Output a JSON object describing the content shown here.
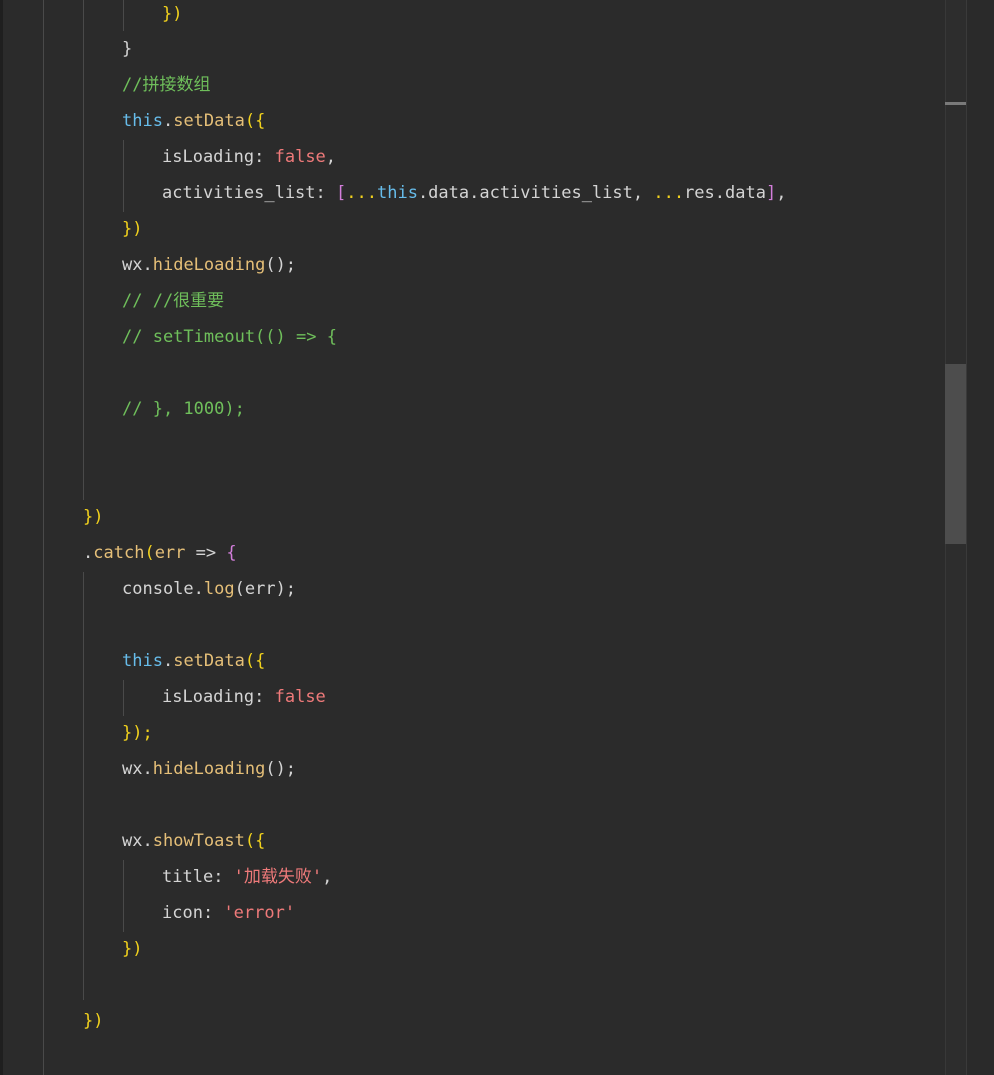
{
  "editor": {
    "colors": {
      "background": "#2b2b2b",
      "keyword": "#67bcea",
      "function": "#e5bf78",
      "brace": "#f2d21d",
      "bracket": "#d37edb",
      "boolean": "#ef7a7a",
      "comment": "#6fbf5b",
      "string": "#ef7a7a"
    },
    "lines": [
      {
        "tokens": [
          {
            "t": "})",
            "c": "brace"
          }
        ]
      },
      {
        "tokens": [
          {
            "t": "}",
            "c": "plain"
          }
        ]
      },
      {
        "tokens": [
          {
            "t": "//拼接数组",
            "c": "comment"
          }
        ]
      },
      {
        "tokens": [
          {
            "t": "this",
            "c": "kw"
          },
          {
            "t": ".",
            "c": "punct"
          },
          {
            "t": "setData",
            "c": "fn"
          },
          {
            "t": "({",
            "c": "brace"
          }
        ]
      },
      {
        "tokens": [
          {
            "t": "isLoading",
            "c": "plain"
          },
          {
            "t": ": ",
            "c": "punct"
          },
          {
            "t": "false",
            "c": "bool"
          },
          {
            "t": ",",
            "c": "punct"
          }
        ]
      },
      {
        "tokens": [
          {
            "t": "activities_list",
            "c": "plain"
          },
          {
            "t": ": ",
            "c": "punct"
          },
          {
            "t": "[",
            "c": "bracket"
          },
          {
            "t": "...",
            "c": "brace"
          },
          {
            "t": "this",
            "c": "kw"
          },
          {
            "t": ".data.activities_list, ",
            "c": "plain"
          },
          {
            "t": "...",
            "c": "brace"
          },
          {
            "t": "res.data",
            "c": "plain"
          },
          {
            "t": "]",
            "c": "bracket"
          },
          {
            "t": ",",
            "c": "punct"
          }
        ]
      },
      {
        "tokens": [
          {
            "t": "})",
            "c": "brace"
          }
        ]
      },
      {
        "tokens": [
          {
            "t": "wx",
            "c": "plain"
          },
          {
            "t": ".",
            "c": "punct"
          },
          {
            "t": "hideLoading",
            "c": "fn"
          },
          {
            "t": "();",
            "c": "punct"
          }
        ]
      },
      {
        "tokens": [
          {
            "t": "// //很重要",
            "c": "comment"
          }
        ]
      },
      {
        "tokens": [
          {
            "t": "// setTimeout(() => {",
            "c": "comment"
          }
        ]
      },
      {
        "tokens": []
      },
      {
        "tokens": [
          {
            "t": "// }, 1000);",
            "c": "comment"
          }
        ]
      },
      {
        "tokens": []
      },
      {
        "tokens": []
      },
      {
        "tokens": [
          {
            "t": "})",
            "c": "brace"
          }
        ]
      },
      {
        "tokens": [
          {
            "t": ".",
            "c": "punct"
          },
          {
            "t": "catch",
            "c": "fn"
          },
          {
            "t": "(",
            "c": "brace"
          },
          {
            "t": "err",
            "c": "param"
          },
          {
            "t": " => ",
            "c": "plain"
          },
          {
            "t": "{",
            "c": "bracket"
          }
        ]
      },
      {
        "tokens": [
          {
            "t": "console",
            "c": "plain"
          },
          {
            "t": ".",
            "c": "punct"
          },
          {
            "t": "log",
            "c": "fn"
          },
          {
            "t": "(err);",
            "c": "punct"
          }
        ]
      },
      {
        "tokens": []
      },
      {
        "tokens": [
          {
            "t": "this",
            "c": "kw"
          },
          {
            "t": ".",
            "c": "punct"
          },
          {
            "t": "setData",
            "c": "fn"
          },
          {
            "t": "({",
            "c": "brace"
          }
        ]
      },
      {
        "tokens": [
          {
            "t": "isLoading",
            "c": "plain"
          },
          {
            "t": ": ",
            "c": "punct"
          },
          {
            "t": "false",
            "c": "bool"
          }
        ]
      },
      {
        "tokens": [
          {
            "t": "});",
            "c": "brace"
          }
        ]
      },
      {
        "tokens": [
          {
            "t": "wx",
            "c": "plain"
          },
          {
            "t": ".",
            "c": "punct"
          },
          {
            "t": "hideLoading",
            "c": "fn"
          },
          {
            "t": "();",
            "c": "punct"
          }
        ]
      },
      {
        "tokens": []
      },
      {
        "tokens": [
          {
            "t": "wx",
            "c": "plain"
          },
          {
            "t": ".",
            "c": "punct"
          },
          {
            "t": "showToast",
            "c": "fn"
          },
          {
            "t": "({",
            "c": "brace"
          }
        ]
      },
      {
        "tokens": [
          {
            "t": "title",
            "c": "plain"
          },
          {
            "t": ": ",
            "c": "punct"
          },
          {
            "t": "'加载失败'",
            "c": "string"
          },
          {
            "t": ",",
            "c": "punct"
          }
        ]
      },
      {
        "tokens": [
          {
            "t": "icon",
            "c": "plain"
          },
          {
            "t": ": ",
            "c": "punct"
          },
          {
            "t": "'error'",
            "c": "string"
          }
        ]
      },
      {
        "tokens": [
          {
            "t": "})",
            "c": "brace"
          }
        ]
      },
      {
        "tokens": []
      },
      {
        "tokens": [
          {
            "t": "})",
            "c": "brace"
          }
        ]
      }
    ]
  }
}
